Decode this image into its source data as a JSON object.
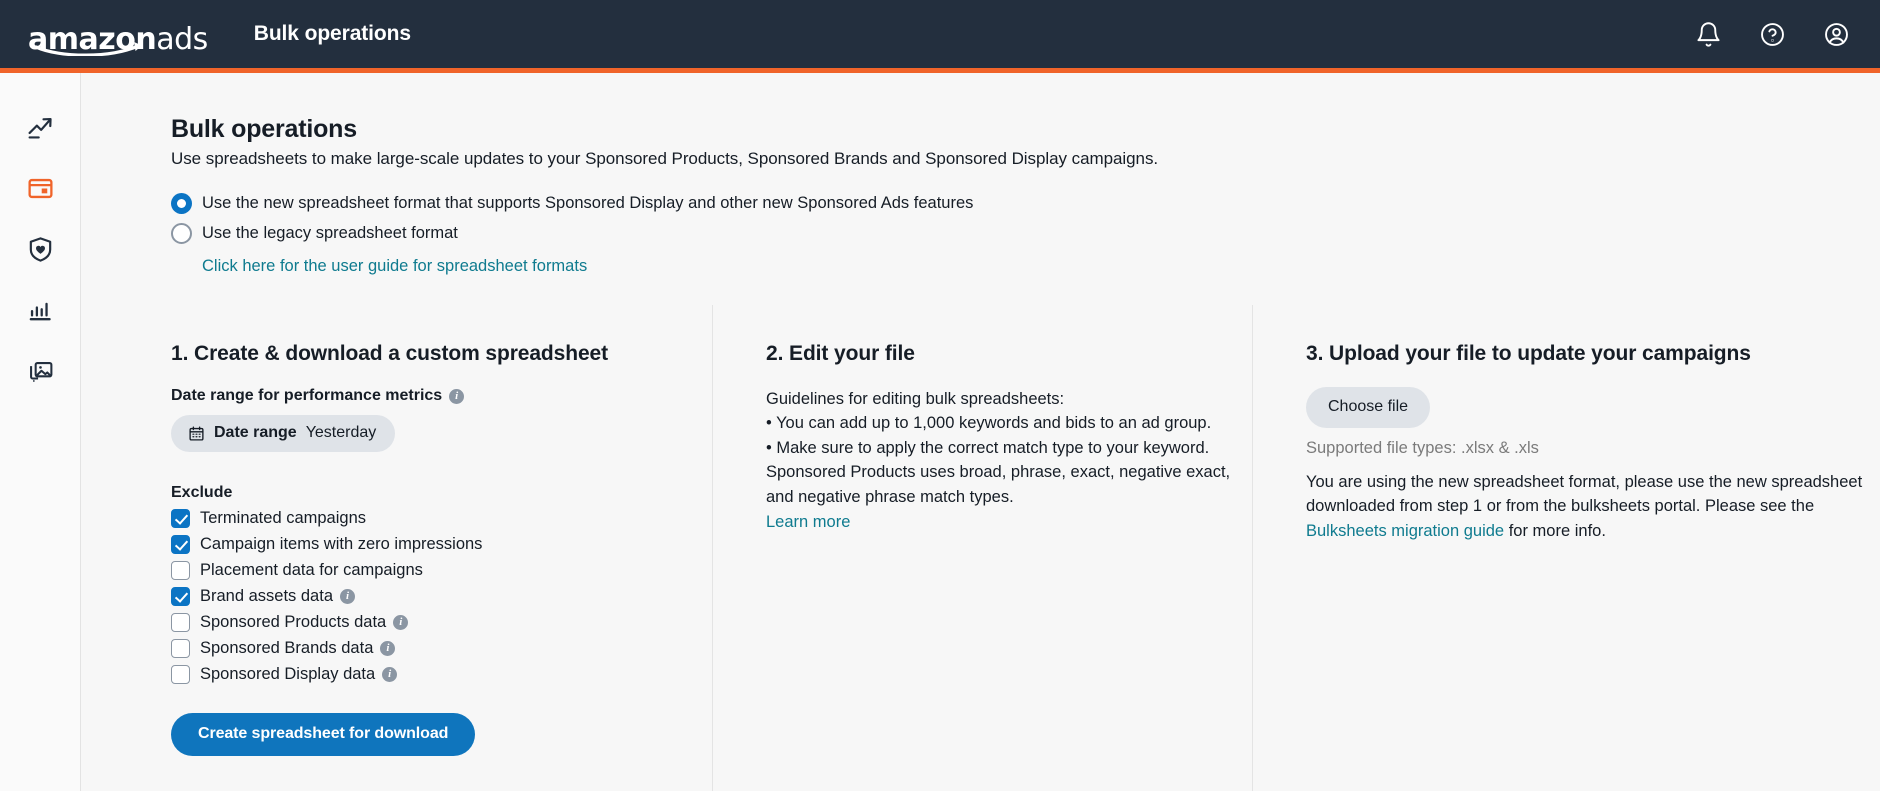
{
  "header": {
    "logo": {
      "brand": "amazon",
      "suffix": "ads",
      "icon": "amazon-swoosh-icon"
    },
    "app_title": "Bulk operations",
    "actions": [
      {
        "name": "notifications-icon",
        "label": "Notifications"
      },
      {
        "name": "help-icon",
        "label": "Help"
      },
      {
        "name": "account-icon",
        "label": "Account"
      }
    ],
    "background": "#232f3e",
    "accent_color": "#f0642a"
  },
  "sidebar": {
    "items": [
      {
        "icon": "trending-up-icon",
        "label": "Performance",
        "active": false
      },
      {
        "icon": "campaign-card-icon",
        "label": "Campaigns",
        "active": true
      },
      {
        "icon": "shield-heart-icon",
        "label": "Brand protection",
        "active": false
      },
      {
        "icon": "bar-chart-icon",
        "label": "Reports",
        "active": false
      },
      {
        "icon": "media-library-icon",
        "label": "Creative assets",
        "active": false
      }
    ],
    "active_color": "#f0642a"
  },
  "page": {
    "title": "Bulk operations",
    "subtitle": "Use spreadsheets to make large-scale updates to your Sponsored Products, Sponsored Brands and Sponsored Display campaigns."
  },
  "format_options": {
    "options": [
      {
        "label": "Use the new spreadsheet format that supports Sponsored Display and other new Sponsored Ads features",
        "selected": true
      },
      {
        "label": "Use the legacy spreadsheet format",
        "selected": false
      }
    ],
    "guide_link": "Click here for the user guide for spreadsheet formats"
  },
  "step1": {
    "title": "1. Create & download a custom spreadsheet",
    "date_range_label": "Date range for performance metrics",
    "date_range_button": {
      "label": "Date range",
      "value": "Yesterday",
      "icon": "calendar-icon"
    },
    "exclude_heading": "Exclude",
    "exclude_items": [
      {
        "label": "Terminated campaigns",
        "checked": true,
        "info": false
      },
      {
        "label": "Campaign items with zero impressions",
        "checked": true,
        "info": false
      },
      {
        "label": "Placement data for campaigns",
        "checked": false,
        "info": false
      },
      {
        "label": "Brand assets data",
        "checked": true,
        "info": true
      },
      {
        "label": "Sponsored Products data",
        "checked": false,
        "info": true
      },
      {
        "label": "Sponsored Brands data",
        "checked": false,
        "info": true
      },
      {
        "label": "Sponsored Display data",
        "checked": false,
        "info": true
      }
    ],
    "create_button": "Create spreadsheet for download"
  },
  "step2": {
    "title": "2. Edit your file",
    "intro": "Guidelines for editing bulk spreadsheets:",
    "bullets": [
      "• You can add up to 1,000 keywords and bids to an ad group.",
      "• Make sure to apply the correct match type to your keyword. Sponsored Products uses broad, phrase, exact, negative exact, and negative phrase match types."
    ],
    "learn_more": "Learn more"
  },
  "step3": {
    "title": "3. Upload your file to update your campaigns",
    "choose_file": "Choose file",
    "supported": "Supported file types: .xlsx & .xls",
    "note_part1": "You are using the new spreadsheet format, please use the new spreadsheet downloaded from step 1 or from the bulksheets portal. Please see the ",
    "note_link": "Bulksheets migration guide",
    "note_part2": " for more info."
  },
  "colors": {
    "link": "#0f7b8f",
    "primary_button": "#0f75bd",
    "checkbox_checked": "#0b74c4",
    "page_background": "#f7f7f7"
  }
}
